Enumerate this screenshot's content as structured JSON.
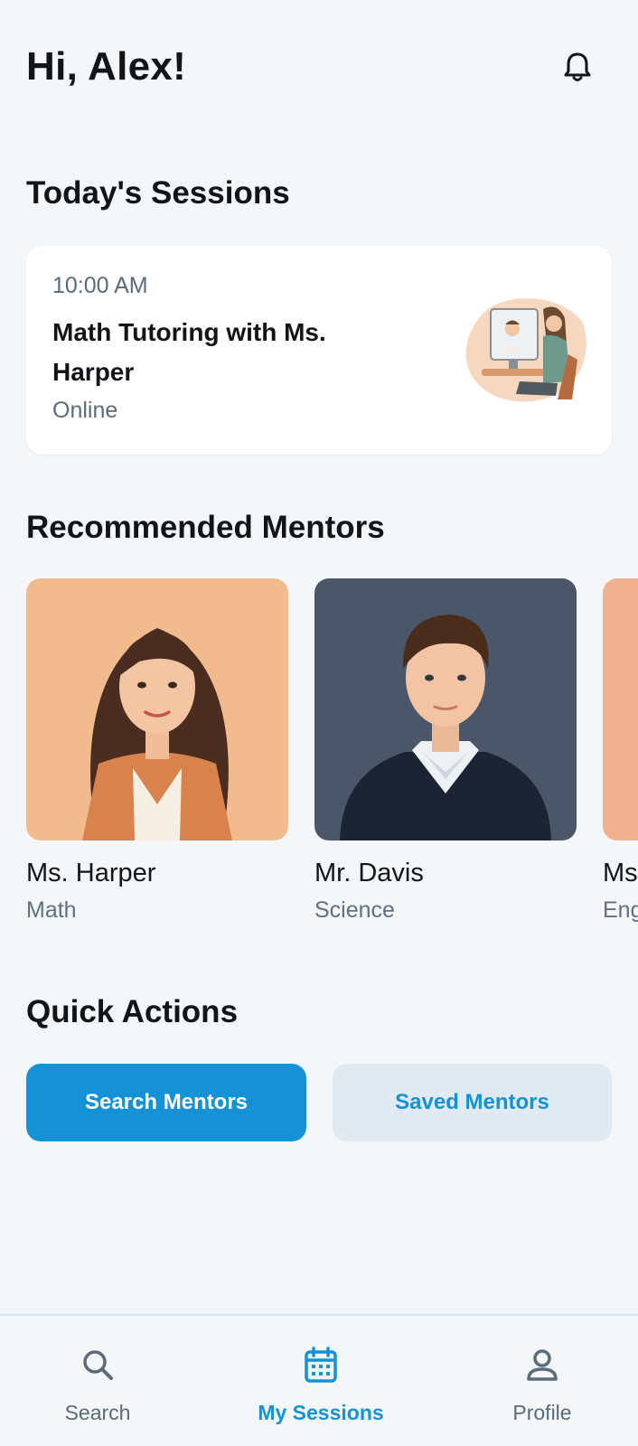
{
  "header": {
    "greeting": "Hi, Alex!"
  },
  "today": {
    "section_title": "Today's Sessions",
    "session": {
      "time": "10:00 AM",
      "title": "Math Tutoring with Ms. Harper",
      "mode": "Online"
    }
  },
  "mentors": {
    "section_title": "Recommended Mentors",
    "items": [
      {
        "name": "Ms. Harper",
        "subject": "Math"
      },
      {
        "name": "Mr. Davis",
        "subject": "Science"
      },
      {
        "name": "Ms",
        "subject": "Eng"
      }
    ]
  },
  "quick_actions": {
    "section_title": "Quick Actions",
    "search_label": "Search Mentors",
    "saved_label": "Saved Mentors"
  },
  "nav": {
    "items": [
      {
        "label": "Search",
        "icon": "search-icon",
        "active": false
      },
      {
        "label": "My Sessions",
        "icon": "calendar-icon",
        "active": true
      },
      {
        "label": "Profile",
        "icon": "person-icon",
        "active": false
      }
    ]
  },
  "colors": {
    "accent": "#1592d6",
    "background": "#f4f6f8",
    "secondary_button": "#e1eaf1",
    "muted_text": "#5b6b79"
  }
}
